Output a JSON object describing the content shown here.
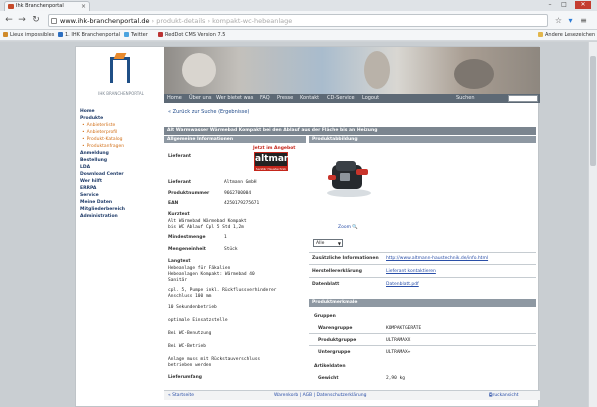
{
  "browser": {
    "tab_title": "Ihk Branchenportal",
    "tab_close": "×",
    "url_host": "www.ihk-branchenportal.de",
    "url_rest": " › produkt-details › kompakt-wc-hebeanlage",
    "win_min": "–",
    "win_max": "□",
    "win_close": "✕",
    "bookmarks": [
      {
        "label": "Lieux impossibles",
        "color": "#d08a2a"
      },
      {
        "label": "1. IHK Branchenportal",
        "color": "#2c6ec0"
      },
      {
        "label": "Twitter",
        "color": "#4aa3df"
      },
      {
        "label": "RedDot CMS Version 7.5",
        "color": "#b33"
      },
      {
        "label": "Andere Lesezeichen",
        "color": "#e2b64c"
      }
    ]
  },
  "site": {
    "logo_text": "IHK BRANCHENPORTAL",
    "topnav": [
      "Home",
      "Über uns",
      "Wer bietet was",
      "FAQ",
      "Presse",
      "Kontakt",
      "CD-Service",
      "Logout"
    ],
    "search_label": "Suchen",
    "breadcrumb": "« Zurück zur Suche (Ergebnisse)",
    "title": "Alt Warmwasser Wärmebad Kompakt bei den Ablauf aus der Fläche bis an Heizung",
    "sidebar_main": [
      "Home",
      "Produkte"
    ],
    "sidebar_sub": [
      "Anbieterliste",
      "Anbieterprofil",
      "Produkt-Katalog",
      "Produktanfragen"
    ],
    "sidebar_rest": [
      "Anmeldung",
      "Bestellung",
      "LDA",
      "Download Center",
      "Wer hilft",
      "ERRPA",
      "Service",
      "Meine Daten",
      "Mitgliederbereich",
      "Administration"
    ],
    "left_section": "Allgemeine Informationen",
    "right_section": "Produktabbildung",
    "right_section2": "Produktmerkmale",
    "badge_top": "Jetzt im Angebot",
    "badge_brand": "altmann",
    "badge_bottom": "Sanitär Haustechnik",
    "zoom_label": "Zoom",
    "select_value": "Alle",
    "left_fields": [
      {
        "label": "Lieferant",
        "value": ""
      },
      {
        "label": "Lieferant",
        "value": "Altmann GmbH"
      },
      {
        "label": "Produktnummer",
        "value": "9662700004"
      },
      {
        "label": "EAN",
        "value": "4250179275671"
      },
      {
        "label": "Kurztext",
        "value": ""
      },
      {
        "label": "",
        "value": "Alt Wärmebad Wärmebad Kompakt"
      },
      {
        "label": "",
        "value": "bis WC Ablauf Cpl 5 Std 1,2m"
      },
      {
        "label": "Mindestmenge",
        "value": "1"
      },
      {
        "label": "Mengeneinheit",
        "value": "Stück"
      },
      {
        "label": "Langtext",
        "value": ""
      },
      {
        "label": "",
        "value": "Hebeanlage für Fäkalien"
      },
      {
        "label": "",
        "value": "Hebeanlagen Kompakt: Wärmebad 40"
      },
      {
        "label": "",
        "value": "Sanitär"
      },
      {
        "label": "",
        "value": "cpl. 5, Pumpe inkl. Rückflussverhinderer"
      },
      {
        "label": "",
        "value": "Anschluss 100 mm"
      },
      {
        "label": "",
        "value": "10 Sekundenbetrieb"
      },
      {
        "label": "",
        "value": "optimale Einsatzstelle"
      },
      {
        "label": "",
        "value": "Bei WC-Benutzung"
      },
      {
        "label": "",
        "value": "Bei WC-Betrieb"
      },
      {
        "label": "",
        "value": "Anlage muss mit Rückstauverschluss"
      },
      {
        "label": "",
        "value": "betrieben werden"
      },
      {
        "label": "Lieferumfang",
        "value": ""
      }
    ],
    "right_fields": [
      {
        "label": "Zusätzliche Informationen",
        "value": "http://www.altmann-haustechnik.de/info.html"
      },
      {
        "label": "Herstellererklärung",
        "value": "Lieferant kontaktieren"
      },
      {
        "label": "Datenblatt",
        "value": "Datenblatt.pdf"
      }
    ],
    "merkmale": [
      {
        "label": "Gruppen",
        "value": ""
      },
      {
        "label": "Warengruppe",
        "value": "KOMPAKTGERÄTE"
      },
      {
        "label": "Produktgruppe",
        "value": "ULTRAMAXX"
      },
      {
        "label": "Untergruppe",
        "value": "ULTRAMAX+"
      },
      {
        "label": "Artikeldaten",
        "value": ""
      },
      {
        "label": "Gewicht",
        "value": "2,90 kg"
      }
    ],
    "footer": {
      "left": "« Startseite",
      "mid": "Warenkorb | AGB | Datenschutzerklärung",
      "right": "Druckansicht"
    }
  }
}
